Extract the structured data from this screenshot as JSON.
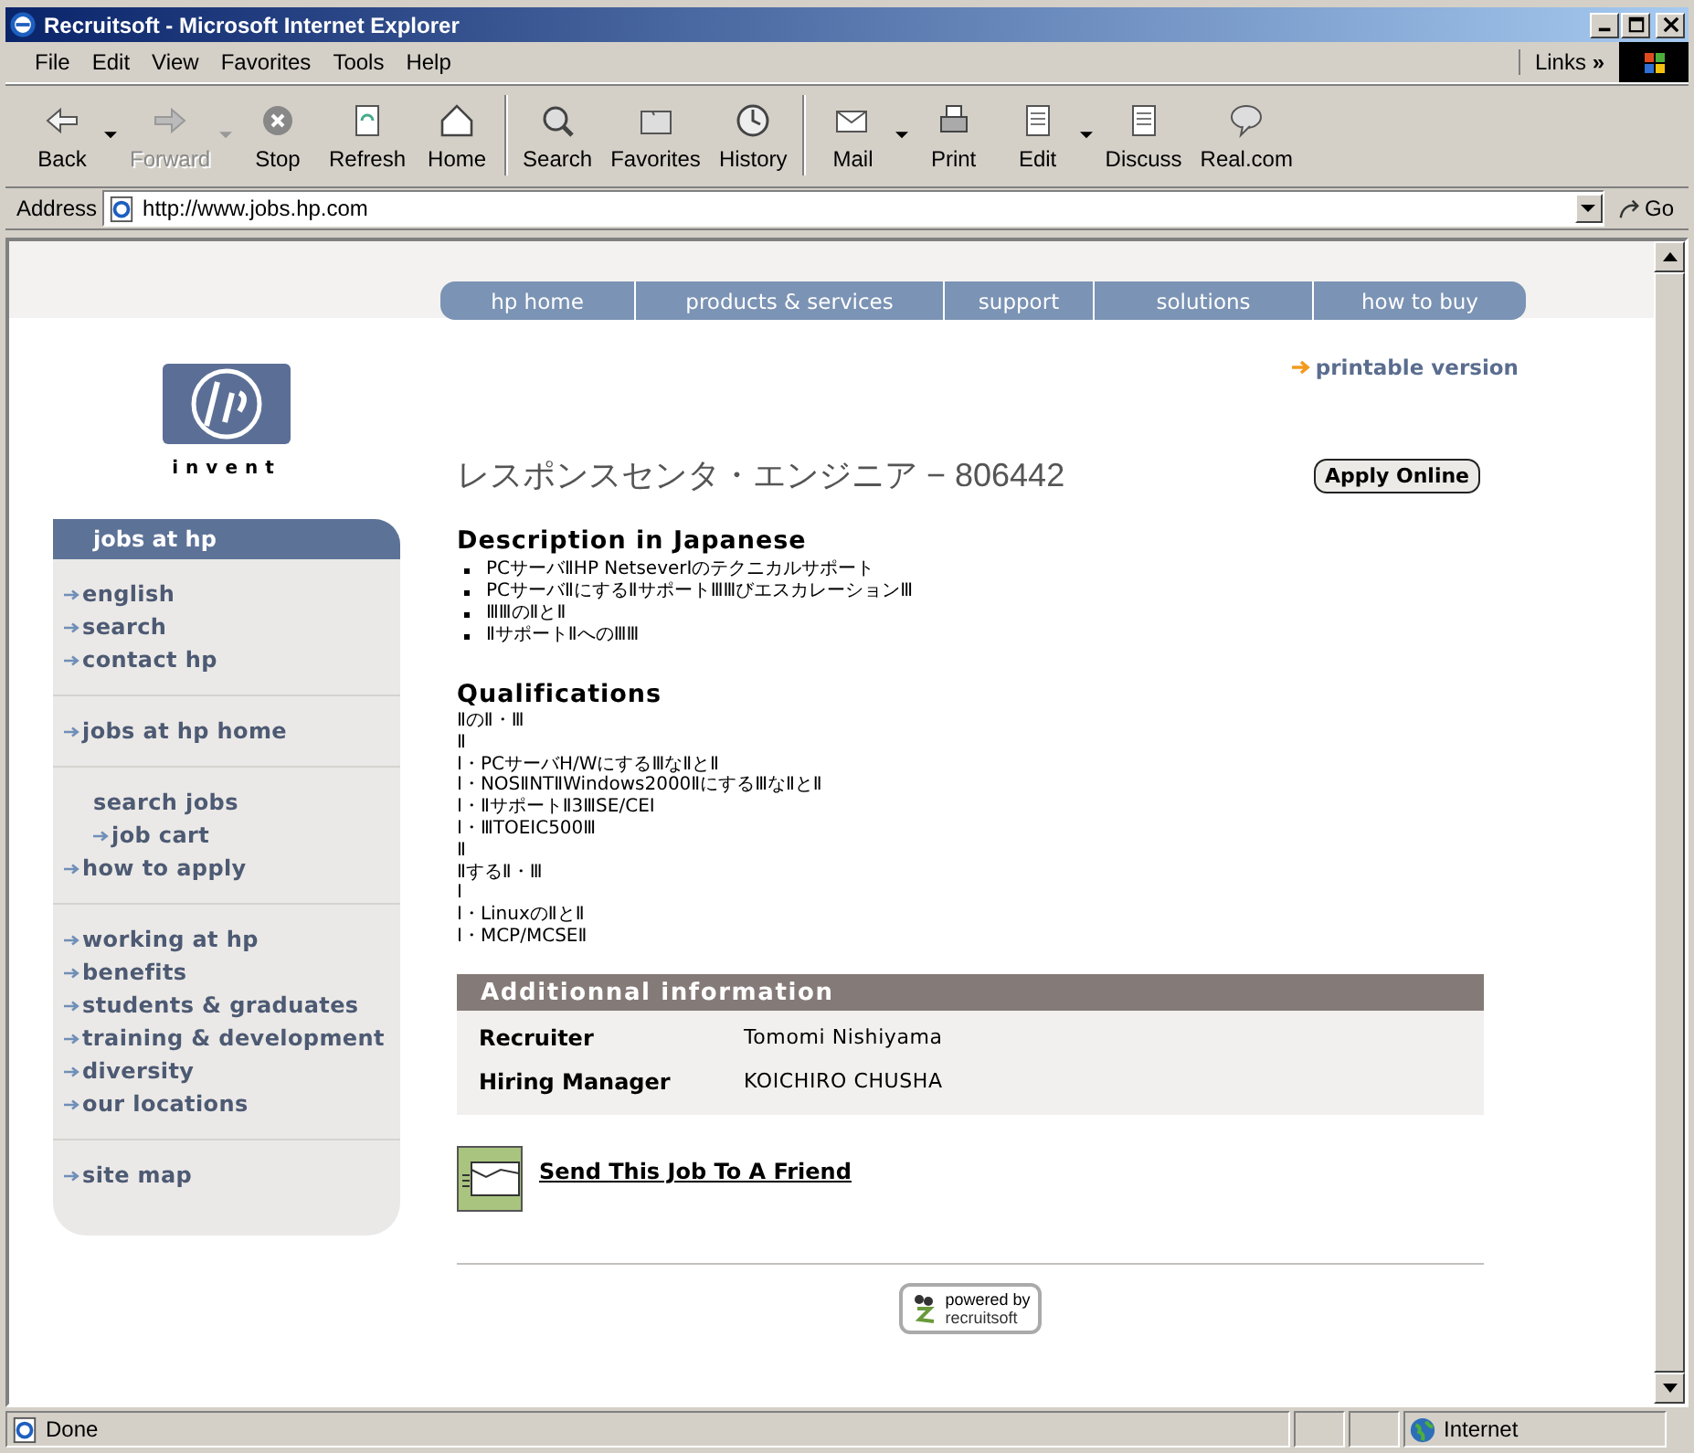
{
  "window": {
    "title": "Recruitsoft - Microsoft Internet Explorer"
  },
  "menu": [
    "File",
    "Edit",
    "View",
    "Favorites",
    "Tools",
    "Help"
  ],
  "links": {
    "label": "Links",
    "chevron": "»"
  },
  "toolbar": [
    {
      "label": "Back",
      "disabled": false,
      "dropdown": true
    },
    {
      "label": "Forward",
      "disabled": true,
      "dropdown": true
    },
    {
      "label": "Stop",
      "disabled": false,
      "dropdown": false
    },
    {
      "label": "Refresh",
      "disabled": false,
      "dropdown": false
    },
    {
      "label": "Home",
      "disabled": false,
      "dropdown": false
    },
    {
      "label": "Search",
      "disabled": false,
      "dropdown": false
    },
    {
      "label": "Favorites",
      "disabled": false,
      "dropdown": false
    },
    {
      "label": "History",
      "disabled": false,
      "dropdown": false
    },
    {
      "label": "Mail",
      "disabled": false,
      "dropdown": true
    },
    {
      "label": "Print",
      "disabled": false,
      "dropdown": false
    },
    {
      "label": "Edit",
      "disabled": false,
      "dropdown": true
    },
    {
      "label": "Discuss",
      "disabled": false,
      "dropdown": false
    },
    {
      "label": "Real.com",
      "disabled": false,
      "dropdown": false
    }
  ],
  "address": {
    "label": "Address",
    "url": "http://www.jobs.hp.com",
    "go": "Go"
  },
  "nav_tabs": [
    "hp home",
    "products & services",
    "support",
    "solutions",
    "how to buy"
  ],
  "printable": "printable version",
  "logo": {
    "tagline": "invent"
  },
  "sidebar": {
    "header": "jobs at hp",
    "groups": [
      {
        "items": [
          {
            "label": "english",
            "arrow": true
          },
          {
            "label": "search",
            "arrow": true
          },
          {
            "label": "contact hp",
            "arrow": true
          }
        ]
      },
      {
        "items": [
          {
            "label": "jobs at hp home",
            "arrow": true
          }
        ]
      },
      {
        "items": [
          {
            "label": "search jobs",
            "arrow": false,
            "children": [
              {
                "label": "job cart",
                "arrow": true
              }
            ]
          },
          {
            "label": "how to apply",
            "arrow": true
          }
        ]
      },
      {
        "items": [
          {
            "label": "working at hp",
            "arrow": true
          },
          {
            "label": "benefits",
            "arrow": true
          },
          {
            "label": "students & graduates",
            "arrow": true
          },
          {
            "label": "training & development",
            "arrow": true
          },
          {
            "label": "diversity",
            "arrow": true
          },
          {
            "label": "our locations",
            "arrow": true
          }
        ]
      },
      {
        "items": [
          {
            "label": "site map",
            "arrow": true
          }
        ]
      }
    ]
  },
  "job": {
    "title": "レスポンスセンタ・エンジニア − 806442",
    "apply": "Apply Online"
  },
  "description": {
    "heading": "Description in Japanese",
    "bullets": [
      "PCサーバⅡHP NetseverⅠのテクニカルサポート",
      "PCサーバⅡにするⅡサポートⅢⅢびエスカレーションⅢ",
      "ⅢⅢのⅡとⅡ",
      "ⅡサポートⅡへのⅢⅢ"
    ]
  },
  "qualifications": {
    "heading": "Qualifications",
    "lines": [
      "ⅡのⅡ・Ⅲ",
      "Ⅱ",
      "Ⅰ・PCサーバH/WにするⅢなⅡとⅡ",
      "Ⅰ・NOSⅡNTⅡWindows2000ⅡにするⅢなⅡとⅡ",
      "Ⅰ・ⅡサポートⅡ3ⅢSE/CEⅠ",
      "Ⅰ・ⅢTOEIC500Ⅲ",
      "Ⅱ",
      "ⅡするⅡ・Ⅲ",
      "Ⅰ",
      "Ⅰ・LinuxのⅡとⅡ",
      "Ⅰ・MCP/MCSEⅡ"
    ]
  },
  "additional": {
    "heading": "Additionnal information",
    "rows": [
      {
        "label": "Recruiter",
        "value": "Tomomi Nishiyama"
      },
      {
        "label": "Hiring Manager",
        "value": "KOICHIRO CHUSHA"
      }
    ]
  },
  "send_link": "Send This Job To A Friend",
  "powered": {
    "line1": "powered by",
    "line2": "recruitsoft"
  },
  "status": {
    "text": "Done",
    "zone": "Internet"
  }
}
